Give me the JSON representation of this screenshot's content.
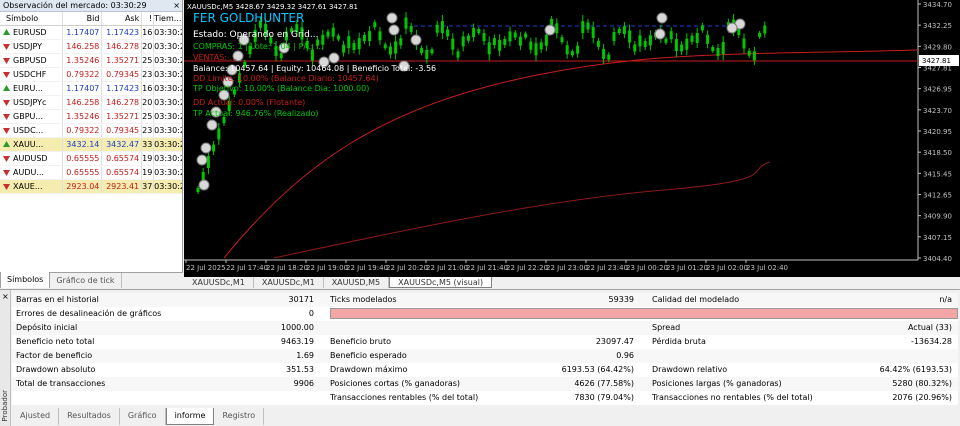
{
  "market_watch": {
    "title": "Observación del mercado: 03:30:29",
    "close": "×",
    "headers": [
      "Símbolo",
      "Bid",
      "Ask",
      "!",
      "Tiem..."
    ],
    "rows": [
      {
        "symbol": "EURUSD",
        "bid": "1.17407",
        "ask": "1.17423",
        "spread": "16",
        "time": "03:30:28",
        "dir": "up",
        "highlight": false
      },
      {
        "symbol": "USDJPY",
        "bid": "146.258",
        "ask": "146.278",
        "spread": "20",
        "time": "03:30:28",
        "dir": "dn",
        "highlight": false
      },
      {
        "symbol": "GBPUSD",
        "bid": "1.35246",
        "ask": "1.35271",
        "spread": "25",
        "time": "03:30:28",
        "dir": "dn",
        "highlight": false
      },
      {
        "symbol": "USDCHF",
        "bid": "0.79322",
        "ask": "0.79345",
        "spread": "23",
        "time": "03:30:28",
        "dir": "dn",
        "highlight": false
      },
      {
        "symbol": "EURU...",
        "bid": "1.17407",
        "ask": "1.17423",
        "spread": "16",
        "time": "03:30:28",
        "dir": "up",
        "highlight": false
      },
      {
        "symbol": "USDJPYc",
        "bid": "146.258",
        "ask": "146.278",
        "spread": "20",
        "time": "03:30:28",
        "dir": "dn",
        "highlight": false
      },
      {
        "symbol": "GBPU...",
        "bid": "1.35246",
        "ask": "1.35271",
        "spread": "25",
        "time": "03:30:28",
        "dir": "dn",
        "highlight": false
      },
      {
        "symbol": "USDC...",
        "bid": "0.79322",
        "ask": "0.79345",
        "spread": "23",
        "time": "03:30:28",
        "dir": "dn",
        "highlight": false
      },
      {
        "symbol": "XAUU...",
        "bid": "3432.14",
        "ask": "3432.47",
        "spread": "33",
        "time": "03:30:28",
        "dir": "up",
        "highlight": true
      },
      {
        "symbol": "AUDUSD",
        "bid": "0.65555",
        "ask": "0.65574",
        "spread": "19",
        "time": "03:30:28",
        "dir": "dn",
        "highlight": false
      },
      {
        "symbol": "AUDU...",
        "bid": "0.65555",
        "ask": "0.65574",
        "spread": "19",
        "time": "03:30:28",
        "dir": "dn",
        "highlight": false
      },
      {
        "symbol": "XAUE...",
        "bid": "2923.04",
        "ask": "2923.41",
        "spread": "37",
        "time": "03:30:29",
        "dir": "dn",
        "highlight": true
      }
    ],
    "tabs": [
      "Símbolos",
      "Gráfico de tick"
    ]
  },
  "chart": {
    "header": "XAUUSDc,M5  3428.67 3429.32 3427.61 3427.81",
    "overlay": {
      "title": "FER GOLDHUNTER",
      "status": "Estado: Operando en Grid...",
      "buy_line": "COMPRAS: 1 | Lote: 1.04 | P/L: ...",
      "sell_line": "VENTAS: ...",
      "balance_line": "Balance: 10457.64 | Equity: 10464.08 | Beneficio Total: -3.56",
      "dd_line": "DD Limite: 10.00% (Balance Diario: 10457.64)",
      "tp_line": "TP Objetivo: 10.00% (Balance Dia: 1000.00)",
      "dd_actual": "DD Actual: 0.00% (Flotante)",
      "tp_actual": "TP Actual: 946.76% (Realizado)"
    },
    "price_labels": [
      "3434.70",
      "3432.25",
      "3429.80",
      "3427.81",
      "3426.95",
      "3423.70",
      "3420.95",
      "3418.50",
      "3415.45",
      "3412.65",
      "3409.90",
      "3407.15",
      "3404.40"
    ],
    "current_price": "3427.81",
    "time_labels": [
      "22 Jul 2025",
      "22 Jul 17:40",
      "22 Jul 18:20",
      "22 Jul 19:00",
      "22 Jul 19:40",
      "22 Jul 20:20",
      "22 Jul 21:00",
      "22 Jul 21:40",
      "22 Jul 22:20",
      "22 Jul 23:00",
      "22 Jul 23:40",
      "23 Jul 00:20",
      "23 Jul 01:20",
      "23 Jul 02:00",
      "23 Jul 02:40"
    ],
    "tabs": [
      "XAUUSDc,M1",
      "XAUUSDc,M1",
      "XAUUSD,M5",
      "XAUUSDc,M5 (visual)"
    ],
    "active_tab": 3,
    "colors": {
      "bg": "#000000",
      "candle": "#00c800",
      "ma1": "#c81e1e",
      "ma2": "#8b1a1a",
      "title": "#00c8ff",
      "white": "#ffffff",
      "green": "#00c800",
      "red": "#c81e1e",
      "dark_red": "#8b1a1a"
    }
  },
  "tester": {
    "close": "×",
    "side_label": "Probador",
    "rows": [
      {
        "l1": "Barras en el historial",
        "v1": "30171",
        "l2": "Ticks modelados",
        "v2": "59339",
        "l3": "Calidad del modelado",
        "v3": "n/a"
      },
      {
        "l1": "Errores de desalineación de gráficos",
        "v1": "0",
        "bar": true
      },
      {
        "l1": "Depósito inicial",
        "v1": "1000.00",
        "l2": "",
        "v2": "",
        "l3": "Spread",
        "v3": "Actual (33)"
      },
      {
        "l1": "Beneficio neto total",
        "v1": "9463.19",
        "l2": "Beneficio bruto",
        "v2": "23097.47",
        "l3": "Pérdida bruta",
        "v3": "-13634.28"
      },
      {
        "l1": "Factor de beneficio",
        "v1": "1.69",
        "l2": "Beneficio esperado",
        "v2": "0.96",
        "l3": "",
        "v3": ""
      },
      {
        "l1": "Drawdown absoluto",
        "v1": "351.53",
        "l2": "Drawdown máximo",
        "v2": "6193.53 (64.42%)",
        "l3": "Drawdown relativo",
        "v3": "64.42% (6193.53)"
      },
      {
        "l1": "Total de transacciones",
        "v1": "9906",
        "l2": "Posiciones cortas (% ganadoras)",
        "v2": "4626 (77.58%)",
        "l3": "Posiciones largas (% ganadoras)",
        "v3": "5280 (80.32%)"
      },
      {
        "l1": "",
        "v1": "",
        "l2": "Transacciones rentables (% del total)",
        "v2": "7830 (79.04%)",
        "l3": "Transacciones no rentables (% del total)",
        "v3": "2076 (20.96%)"
      }
    ],
    "tabs": [
      "Ajusted",
      "Resultados",
      "Gráfico",
      "informe",
      "Registro"
    ],
    "active_tab": 3
  }
}
